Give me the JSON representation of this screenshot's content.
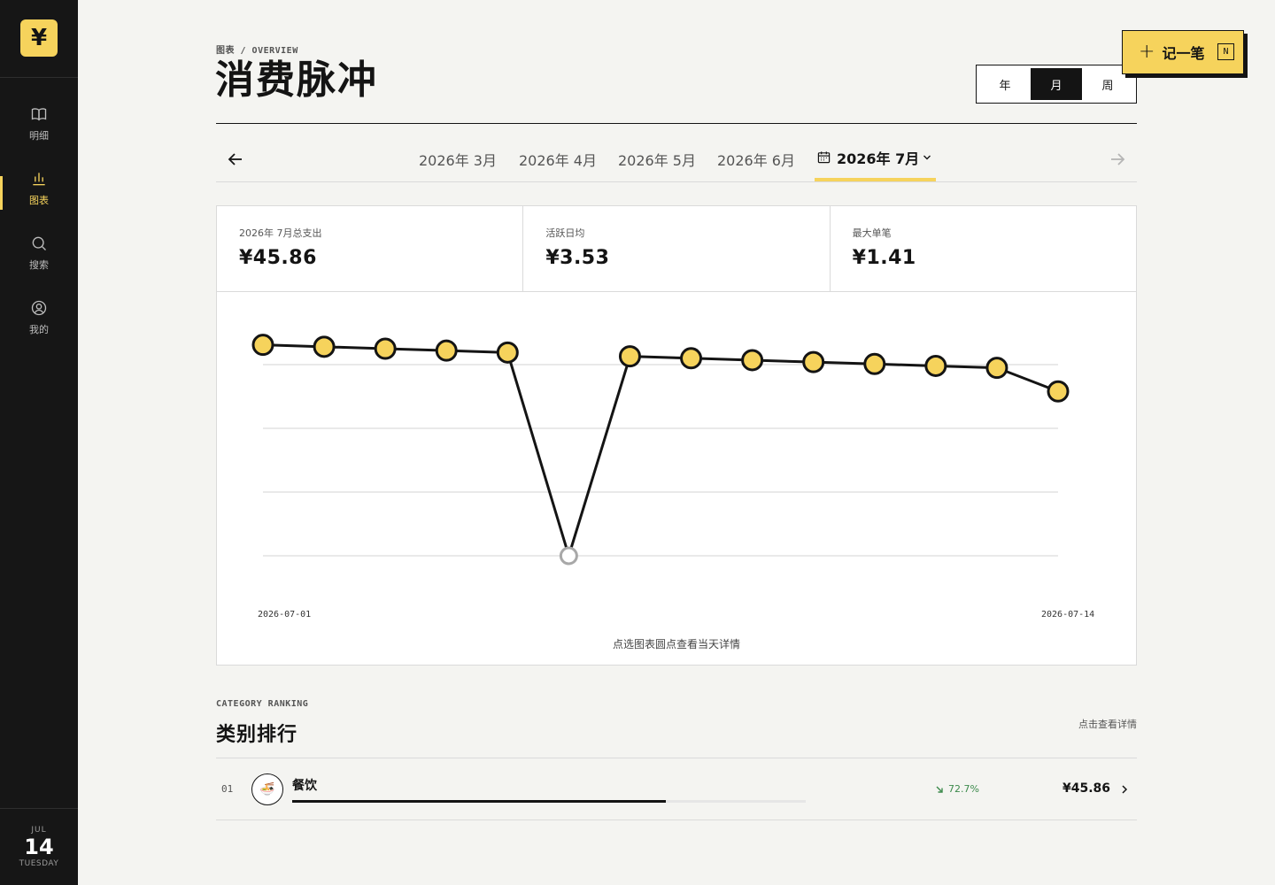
{
  "app": {
    "logo": "¥"
  },
  "sidebar": {
    "items": [
      {
        "label": "明细",
        "icon": "book-icon",
        "active": false
      },
      {
        "label": "图表",
        "icon": "bar-chart-icon",
        "active": true
      },
      {
        "label": "搜索",
        "icon": "search-icon",
        "active": false
      },
      {
        "label": "我的",
        "icon": "user-circle-icon",
        "active": false
      }
    ],
    "date": {
      "month": "JUL",
      "day": "14",
      "weekday": "TUESDAY"
    }
  },
  "header": {
    "breadcrumb": "图表 / OVERVIEW",
    "title": "消费脉冲",
    "period_options": [
      "年",
      "月",
      "周"
    ],
    "period_selected": "月",
    "add_button": {
      "label": "记一笔",
      "shortcut": "N"
    }
  },
  "months": {
    "tabs": [
      "2026年 3月",
      "2026年 4月",
      "2026年 5月",
      "2026年 6月"
    ],
    "current": "2026年 7月"
  },
  "stats": [
    {
      "label": "2026年 7月总支出",
      "value": "¥45.86"
    },
    {
      "label": "活跃日均",
      "value": "¥3.53"
    },
    {
      "label": "最大单笔",
      "value": "¥1.41"
    }
  ],
  "chart_data": {
    "type": "line",
    "x": [
      "2026-07-01",
      "2026-07-02",
      "2026-07-03",
      "2026-07-04",
      "2026-07-05",
      "2026-07-06",
      "2026-07-07",
      "2026-07-08",
      "2026-07-09",
      "2026-07-10",
      "2026-07-11",
      "2026-07-12",
      "2026-07-13",
      "2026-07-14"
    ],
    "values": [
      3.31,
      3.28,
      3.25,
      3.22,
      3.19,
      0,
      3.13,
      3.1,
      3.07,
      3.04,
      3.01,
      2.98,
      2.95,
      2.58
    ],
    "x_tick_labels": [
      "2026-07-01",
      "2026-07-14"
    ],
    "ylim": [
      0,
      3.0
    ],
    "grid": true,
    "hint": "点选图表圆点查看当天详情"
  },
  "ranking": {
    "eyebrow": "CATEGORY RANKING",
    "title": "类别排行",
    "hint": "点击查看详情",
    "items": [
      {
        "index": "01",
        "icon": "🍜",
        "name": "餐饮",
        "share": 0.727,
        "pct_label": "72.7%",
        "amount": "¥45.86"
      }
    ]
  },
  "colors": {
    "accent": "#f6d35c",
    "dark": "#141414",
    "sidebar": "#161616",
    "down": "#3c8a4c"
  }
}
